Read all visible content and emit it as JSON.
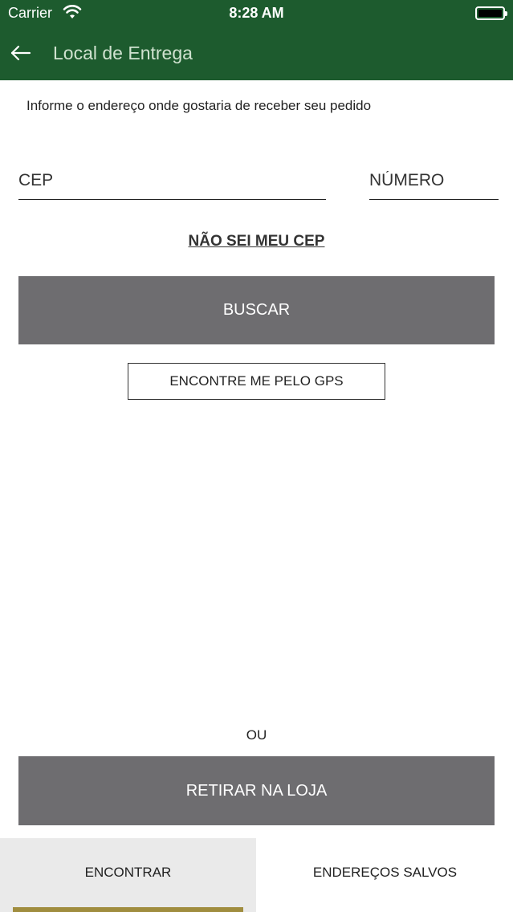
{
  "status_bar": {
    "carrier": "Carrier",
    "time": "8:28 AM",
    "icons": [
      "wifi-icon",
      "battery-icon"
    ]
  },
  "header": {
    "back_icon": "arrow-left-icon",
    "title": "Local de Entrega",
    "background_color": "#1d5b2e"
  },
  "form": {
    "instruction": "Informe o endereço onde gostaria de receber seu pedido",
    "cep_placeholder": "CEP",
    "cep_value": "",
    "numero_placeholder": "NÚMERO",
    "numero_value": "",
    "nao_sei_cep_label": "NÃO SEI MEU CEP",
    "buscar_label": "BUSCAR",
    "gps_label": "ENCONTRE ME PELO GPS",
    "button_color": "#6e6d70"
  },
  "alternative": {
    "ou_label": "OU",
    "retirar_label": "RETIRAR NA LOJA"
  },
  "tabs": [
    {
      "label": "ENCONTRAR",
      "active": true
    },
    {
      "label": "ENDEREÇOS SALVOS",
      "active": false
    }
  ],
  "tab_indicator_color": "#a08d3f"
}
